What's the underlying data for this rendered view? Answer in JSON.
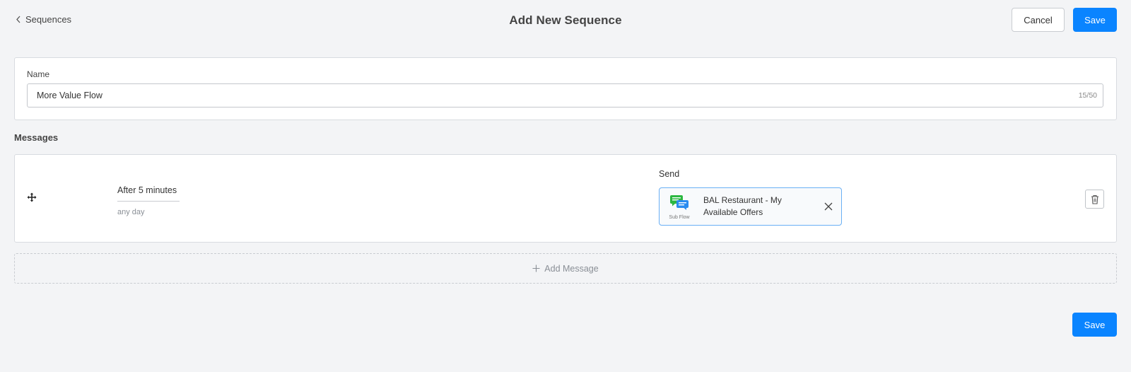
{
  "header": {
    "back_label": "Sequences",
    "title": "Add New Sequence",
    "cancel_label": "Cancel",
    "save_label": "Save"
  },
  "name_section": {
    "label": "Name",
    "value": "More Value Flow",
    "counter": "15/50"
  },
  "messages": {
    "heading": "Messages",
    "items": [
      {
        "delay": "After 5 minutes",
        "schedule": "any day",
        "send_label": "Send",
        "flow": {
          "type_label": "Sub Flow",
          "name": "BAL Restaurant - My Available Offers",
          "icon": "sub-flow-icon"
        }
      }
    ],
    "add_label": "Add Message"
  },
  "footer": {
    "save_label": "Save"
  },
  "colors": {
    "primary": "#0a84ff",
    "background": "#f3f4f6",
    "chip_border": "#6ab0f5",
    "icon_green": "#2cb742",
    "icon_blue": "#2a8cf0"
  }
}
